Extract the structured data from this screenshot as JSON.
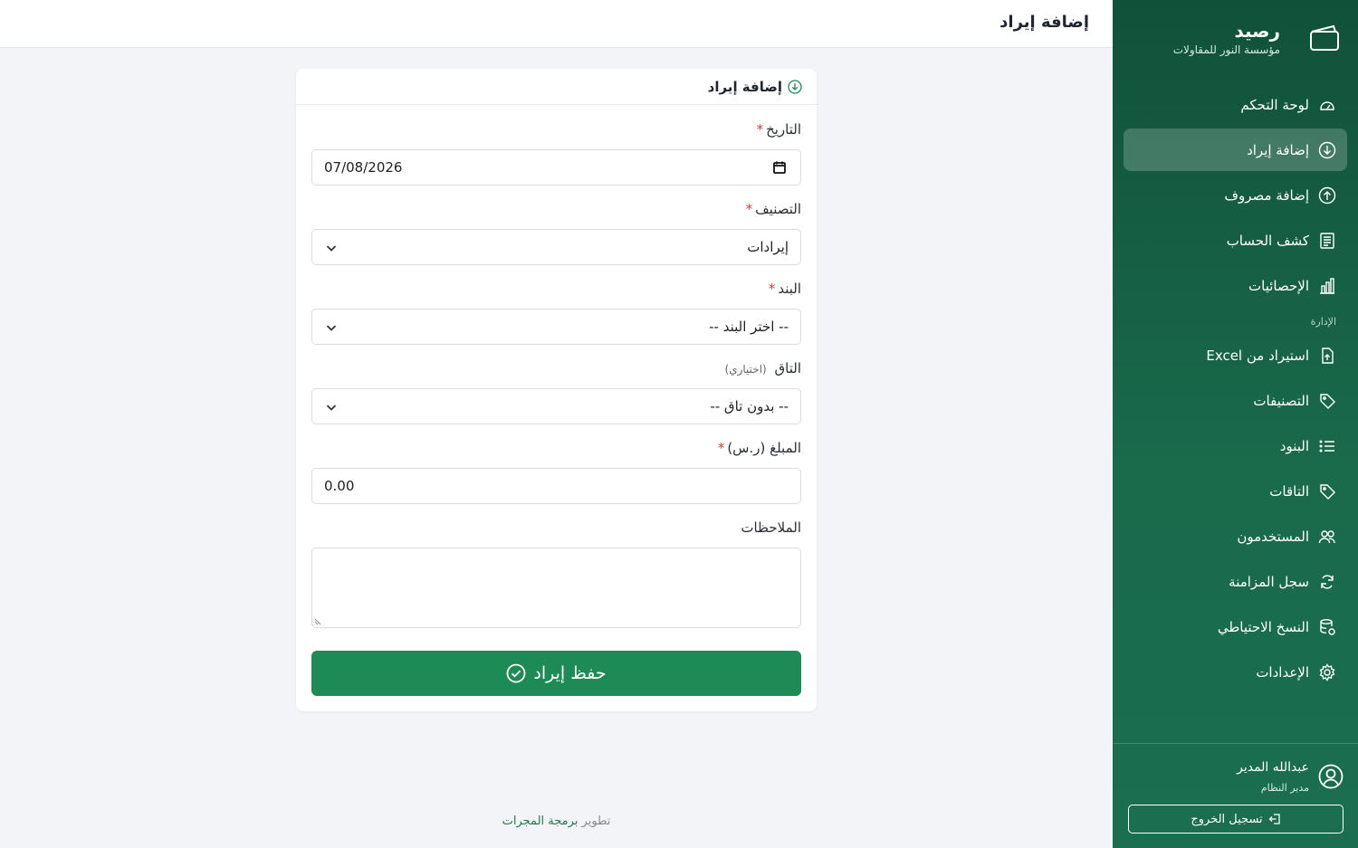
{
  "brand": {
    "name": "رصيد",
    "subtitle": "مؤسسة النور للمقاولات"
  },
  "topbar": {
    "title": "إضافة إيراد"
  },
  "sidebar": {
    "main_items": [
      {
        "label": "لوحة التحكم",
        "icon": "dashboard-icon"
      },
      {
        "label": "إضافة إيراد",
        "icon": "arrow-down-circle-icon",
        "active": true
      },
      {
        "label": "إضافة مصروف",
        "icon": "arrow-up-circle-icon"
      },
      {
        "label": "كشف الحساب",
        "icon": "ledger-icon"
      },
      {
        "label": "الإحصائيات",
        "icon": "bar-chart-icon"
      }
    ],
    "section_label": "الإدارة",
    "admin_items": [
      {
        "label": "استيراد من Excel",
        "icon": "file-upload-icon"
      },
      {
        "label": "التصنيفات",
        "icon": "tag-icon"
      },
      {
        "label": "البنود",
        "icon": "list-icon"
      },
      {
        "label": "التاقات",
        "icon": "tag-icon"
      },
      {
        "label": "المستخدمون",
        "icon": "users-icon"
      },
      {
        "label": "سجل المزامنة",
        "icon": "sync-icon"
      },
      {
        "label": "النسخ الاحتياطي",
        "icon": "database-icon"
      },
      {
        "label": "الإعدادات",
        "icon": "gear-icon"
      }
    ],
    "user": {
      "name": "عبدالله المدير",
      "role": "مدير النظام"
    },
    "logout_label": "تسجيل الخروج"
  },
  "card": {
    "title": "إضافة إيراد",
    "fields": {
      "date": {
        "label": "التاريخ",
        "value": "07/08/2026"
      },
      "category": {
        "label": "التصنيف",
        "value": "إيرادات"
      },
      "item": {
        "label": "البند",
        "value": "-- اختر البند --"
      },
      "tag": {
        "label": "التاق",
        "optional": "(اختياري)",
        "value": "-- بدون تاق --"
      },
      "amount": {
        "label": "المبلغ (ر.س)",
        "value": "0.00"
      },
      "notes": {
        "label": "الملاحظات",
        "value": ""
      }
    },
    "required_mark": "*",
    "submit_label": "حفظ إيراد"
  },
  "footer": {
    "prefix": "تطوير",
    "link": "برمجة المجرات"
  },
  "colors": {
    "sidebar": "#11513a",
    "accent": "#1e8a55",
    "required": "#d63a3a"
  }
}
